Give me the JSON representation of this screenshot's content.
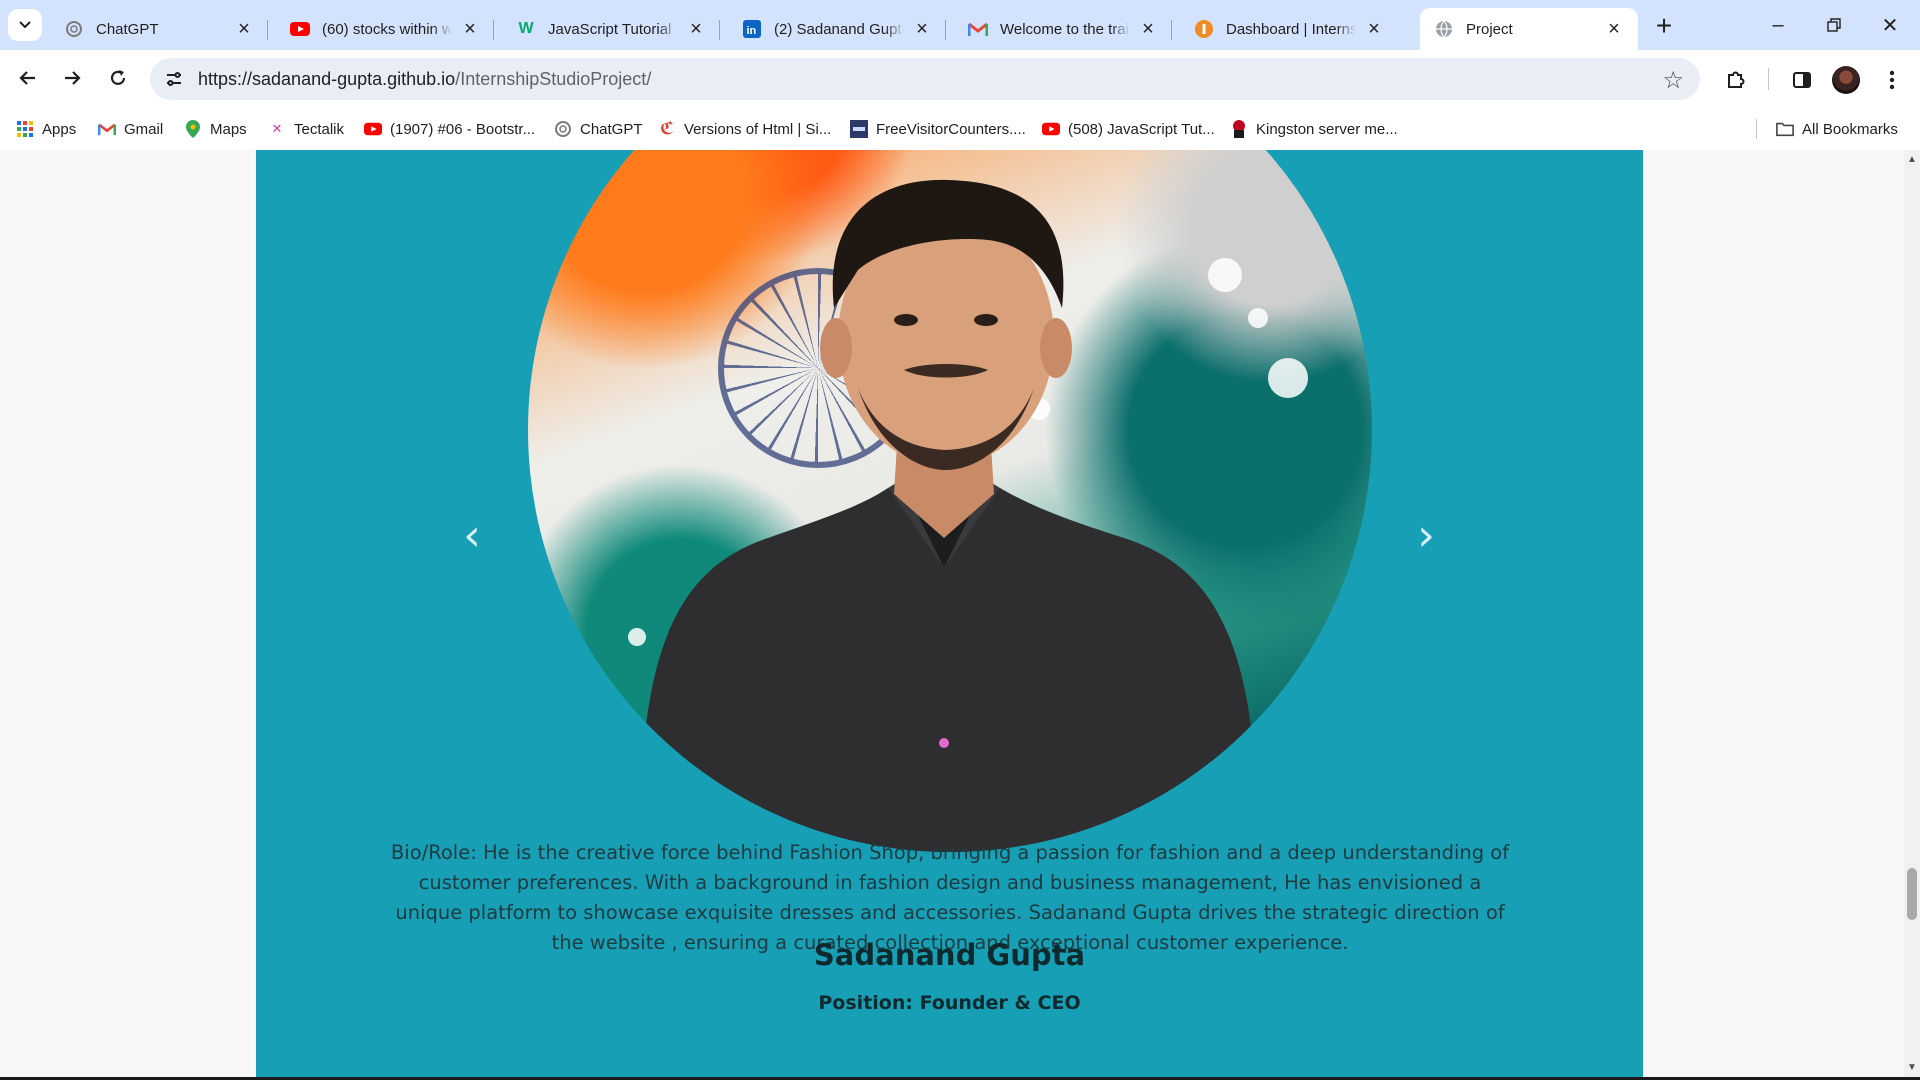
{
  "browser": {
    "tabs": [
      {
        "title": "ChatGPT",
        "icon": "chatgpt-icon",
        "active": false
      },
      {
        "title": "(60) stocks within we",
        "icon": "youtube-icon",
        "active": false
      },
      {
        "title": "JavaScript Tutorial",
        "icon": "w3schools-icon",
        "active": false
      },
      {
        "title": "(2) Sadanand Gupta",
        "icon": "linkedin-icon",
        "active": false
      },
      {
        "title": "Welcome to the train",
        "icon": "gmail-icon",
        "active": false
      },
      {
        "title": "Dashboard | Internsh",
        "icon": "internshala-icon",
        "active": false
      },
      {
        "title": "Project",
        "icon": "globe-icon",
        "active": true
      }
    ],
    "url_host": "https://sadanand-gupta.github.io",
    "url_path": "/InternshipStudioProject/"
  },
  "bookmarks": {
    "items": [
      {
        "label": "Apps",
        "icon": "apps-grid-icon"
      },
      {
        "label": "Gmail",
        "icon": "gmail-icon"
      },
      {
        "label": "Maps",
        "icon": "maps-pin-icon"
      },
      {
        "label": "Tectalik",
        "icon": "tectalik-icon"
      },
      {
        "label": "(1907) #06 - Bootstr...",
        "icon": "youtube-icon"
      },
      {
        "label": "ChatGPT",
        "icon": "chatgpt-icon"
      },
      {
        "label": "Versions of Html | Si...",
        "icon": "versions-icon"
      },
      {
        "label": "FreeVisitorCounters....",
        "icon": "counter-icon"
      },
      {
        "label": "(508) JavaScript Tut...",
        "icon": "youtube-icon"
      },
      {
        "label": "Kingston server me...",
        "icon": "kingston-icon"
      }
    ],
    "all_bookmarks": "All Bookmarks"
  },
  "page": {
    "bio": "Bio/Role: He is the creative force behind Fashion Shop, bringing a passion for fashion and a deep understanding of customer preferences. With a background in fashion design and business management, He has envisioned a unique platform to showcase exquisite dresses and accessories. Sadanand Gupta drives the strategic direction of the website , ensuring a curated collection and exceptional customer experience.",
    "name": "Sadanand Gupta",
    "position": "Position: Founder & CEO",
    "carousel_prev": "‹",
    "carousel_next": "›"
  },
  "colors": {
    "section_bg": "#179fb5",
    "tabstrip_bg": "#d3e3fd",
    "omnibox_bg": "#e9eef6"
  }
}
